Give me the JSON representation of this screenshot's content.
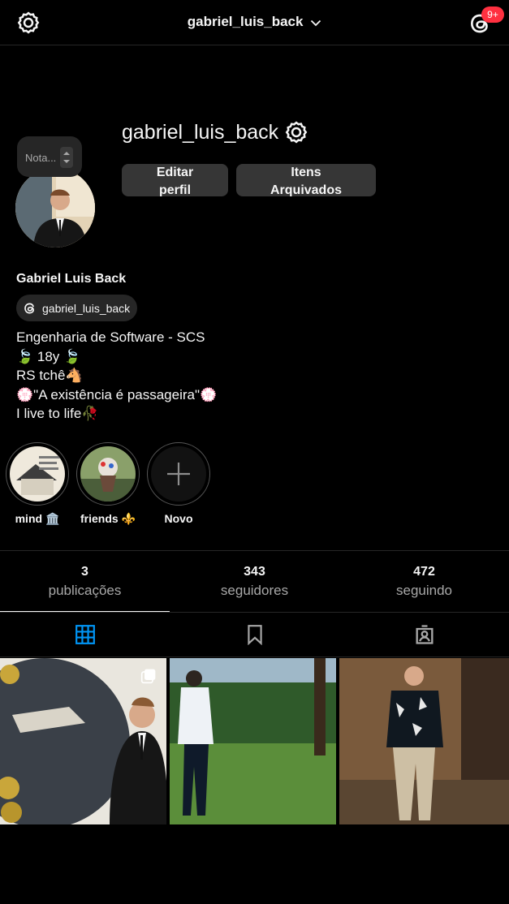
{
  "header": {
    "username": "gabriel_luis_back",
    "notifications_badge": "9+"
  },
  "profile": {
    "username": "gabriel_luis_back",
    "note_placeholder": "Nota...",
    "edit_button": "Editar perfil",
    "archive_button": "Itens Arquivados",
    "full_name": "Gabriel Luis Back",
    "threads_handle": "gabriel_luis_back",
    "bio_lines": [
      "Engenharia de Software - SCS",
      "🍃 18y 🍃",
      "RS tchê🐴",
      "💮\"A existência é passageira\"💮",
      "I live to life🥀"
    ]
  },
  "highlights": [
    {
      "label": "mind 🏛️"
    },
    {
      "label": "friends ⚜️"
    },
    {
      "label": "Novo"
    }
  ],
  "stats": [
    {
      "value": "3",
      "label": "publicações"
    },
    {
      "value": "343",
      "label": "seguidores"
    },
    {
      "value": "472",
      "label": "seguindo"
    }
  ],
  "tabs": [
    {
      "icon": "grid-icon",
      "active": true
    },
    {
      "icon": "bookmark-icon",
      "active": false
    },
    {
      "icon": "tagged-icon",
      "active": false
    }
  ],
  "colors": {
    "background": "#000000",
    "button": "#363636",
    "active_tab": "#0095f6",
    "badge": "#ff3040",
    "secondary_text": "#a8a8a8"
  }
}
